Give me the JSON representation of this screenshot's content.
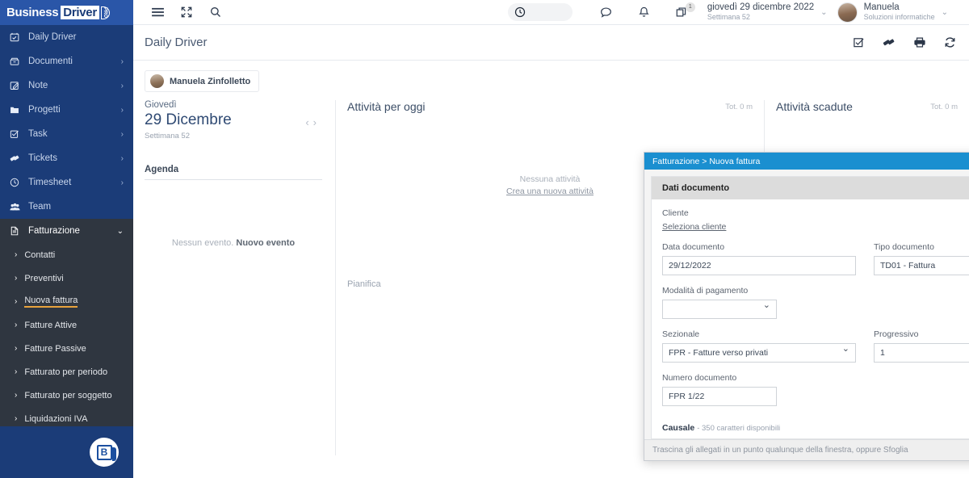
{
  "brand": {
    "logo_business": "Business",
    "logo_driver": "Driver",
    "logo_pro": "PRO",
    "badge_letter": "B"
  },
  "sidebar": {
    "items": [
      {
        "label": "Daily Driver",
        "icon": "calendar-check-icon",
        "chevron": ""
      },
      {
        "label": "Documenti",
        "icon": "archive-icon",
        "chevron": "›"
      },
      {
        "label": "Note",
        "icon": "note-edit-icon",
        "chevron": "›"
      },
      {
        "label": "Progetti",
        "icon": "folder-icon",
        "chevron": "›"
      },
      {
        "label": "Task",
        "icon": "checkbox-icon",
        "chevron": "›"
      },
      {
        "label": "Tickets",
        "icon": "ticket-icon",
        "chevron": "›"
      },
      {
        "label": "Timesheet",
        "icon": "clock-icon",
        "chevron": "›"
      },
      {
        "label": "Team",
        "icon": "team-icon",
        "chevron": ""
      },
      {
        "label": "Fatturazione",
        "icon": "invoice-icon",
        "chevron": "⌄",
        "active": true
      }
    ],
    "submenu": [
      {
        "label": "Contatti",
        "chevron": "›"
      },
      {
        "label": "Preventivi",
        "chevron": "›"
      },
      {
        "label": "Nuova fattura",
        "chevron": "›",
        "selected": true
      },
      {
        "label": "Fatture Attive",
        "chevron": "›"
      },
      {
        "label": "Fatture Passive",
        "chevron": "›"
      },
      {
        "label": "Fatturato per periodo",
        "chevron": "›"
      },
      {
        "label": "Fatturato per soggetto",
        "chevron": "›"
      },
      {
        "label": "Liquidazioni IVA",
        "chevron": "›"
      }
    ],
    "accent_color": "#e8a33d",
    "background_color": "#1b3c78",
    "submenu_background": "#2f3640"
  },
  "topbar": {
    "menu_icon": "hamburger-icon",
    "expand_icon": "fullscreen-icon",
    "search_icon": "search-icon",
    "timer_icon": "clock-icon",
    "chat_icon": "chat-bubble-icon",
    "bell_icon": "bell-icon",
    "windows_icon": "windows-stack-icon",
    "windows_badge": "1",
    "date_main": "giovedì 29 dicembre 2022",
    "date_sub": "Settimana 52",
    "date_chevron": "⌄",
    "user_name": "Manuela",
    "user_org": "Soluzioni informatiche",
    "user_chevron": "⌄",
    "avatar": "avatar"
  },
  "page": {
    "title": "Daily Driver",
    "actions": [
      {
        "icon": "task-check-icon"
      },
      {
        "icon": "ticket-icon"
      },
      {
        "icon": "print-icon"
      },
      {
        "icon": "refresh-icon"
      }
    ],
    "user_chip": "Manuela Zinfolletto"
  },
  "daypanel": {
    "day_of_week": "Giovedì",
    "date": "29 Dicembre",
    "week": "Settimana 52",
    "prev_arrow": "‹",
    "next_arrow": "›",
    "agenda_title": "Agenda",
    "empty_prefix": "Nessun evento.",
    "empty_action": "Nuovo evento"
  },
  "today_panel": {
    "title": "Attività per oggi",
    "total": "Tot. 0 m",
    "empty_text": "Nessuna attività",
    "empty_link": "Crea una nuova attività",
    "plan_label": "Pianifica"
  },
  "overdue_panel": {
    "title": "Attività scadute",
    "total": "Tot. 0 m"
  },
  "modal": {
    "title": "Fatturazione > Nuova fattura",
    "minimize": "–",
    "restore": "↖",
    "close": "✕",
    "section_title": "Dati documento",
    "fields": {
      "cliente_label": "Cliente",
      "cliente_link": "Seleziona cliente",
      "data_documento_label": "Data documento",
      "data_documento_value": "29/12/2022",
      "tipo_documento_label": "Tipo documento",
      "tipo_documento_value": "TD01 - Fattura",
      "modalita_pagamento_label": "Modalità di pagamento",
      "modalita_pagamento_value": "",
      "sezionale_label": "Sezionale",
      "sezionale_value": "FPR - Fatture verso privati",
      "progressivo_label": "Progressivo",
      "progressivo_value": "1",
      "numero_documento_label": "Numero documento",
      "numero_documento_value": "FPR 1/22",
      "causale_label": "Causale",
      "causale_hint": "- 350 caratteri disponibili"
    },
    "footer_text": "Trascina gli allegati in un punto qualunque della finestra, oppure Sfoglia",
    "titlebar_color": "#1a8fd0"
  }
}
